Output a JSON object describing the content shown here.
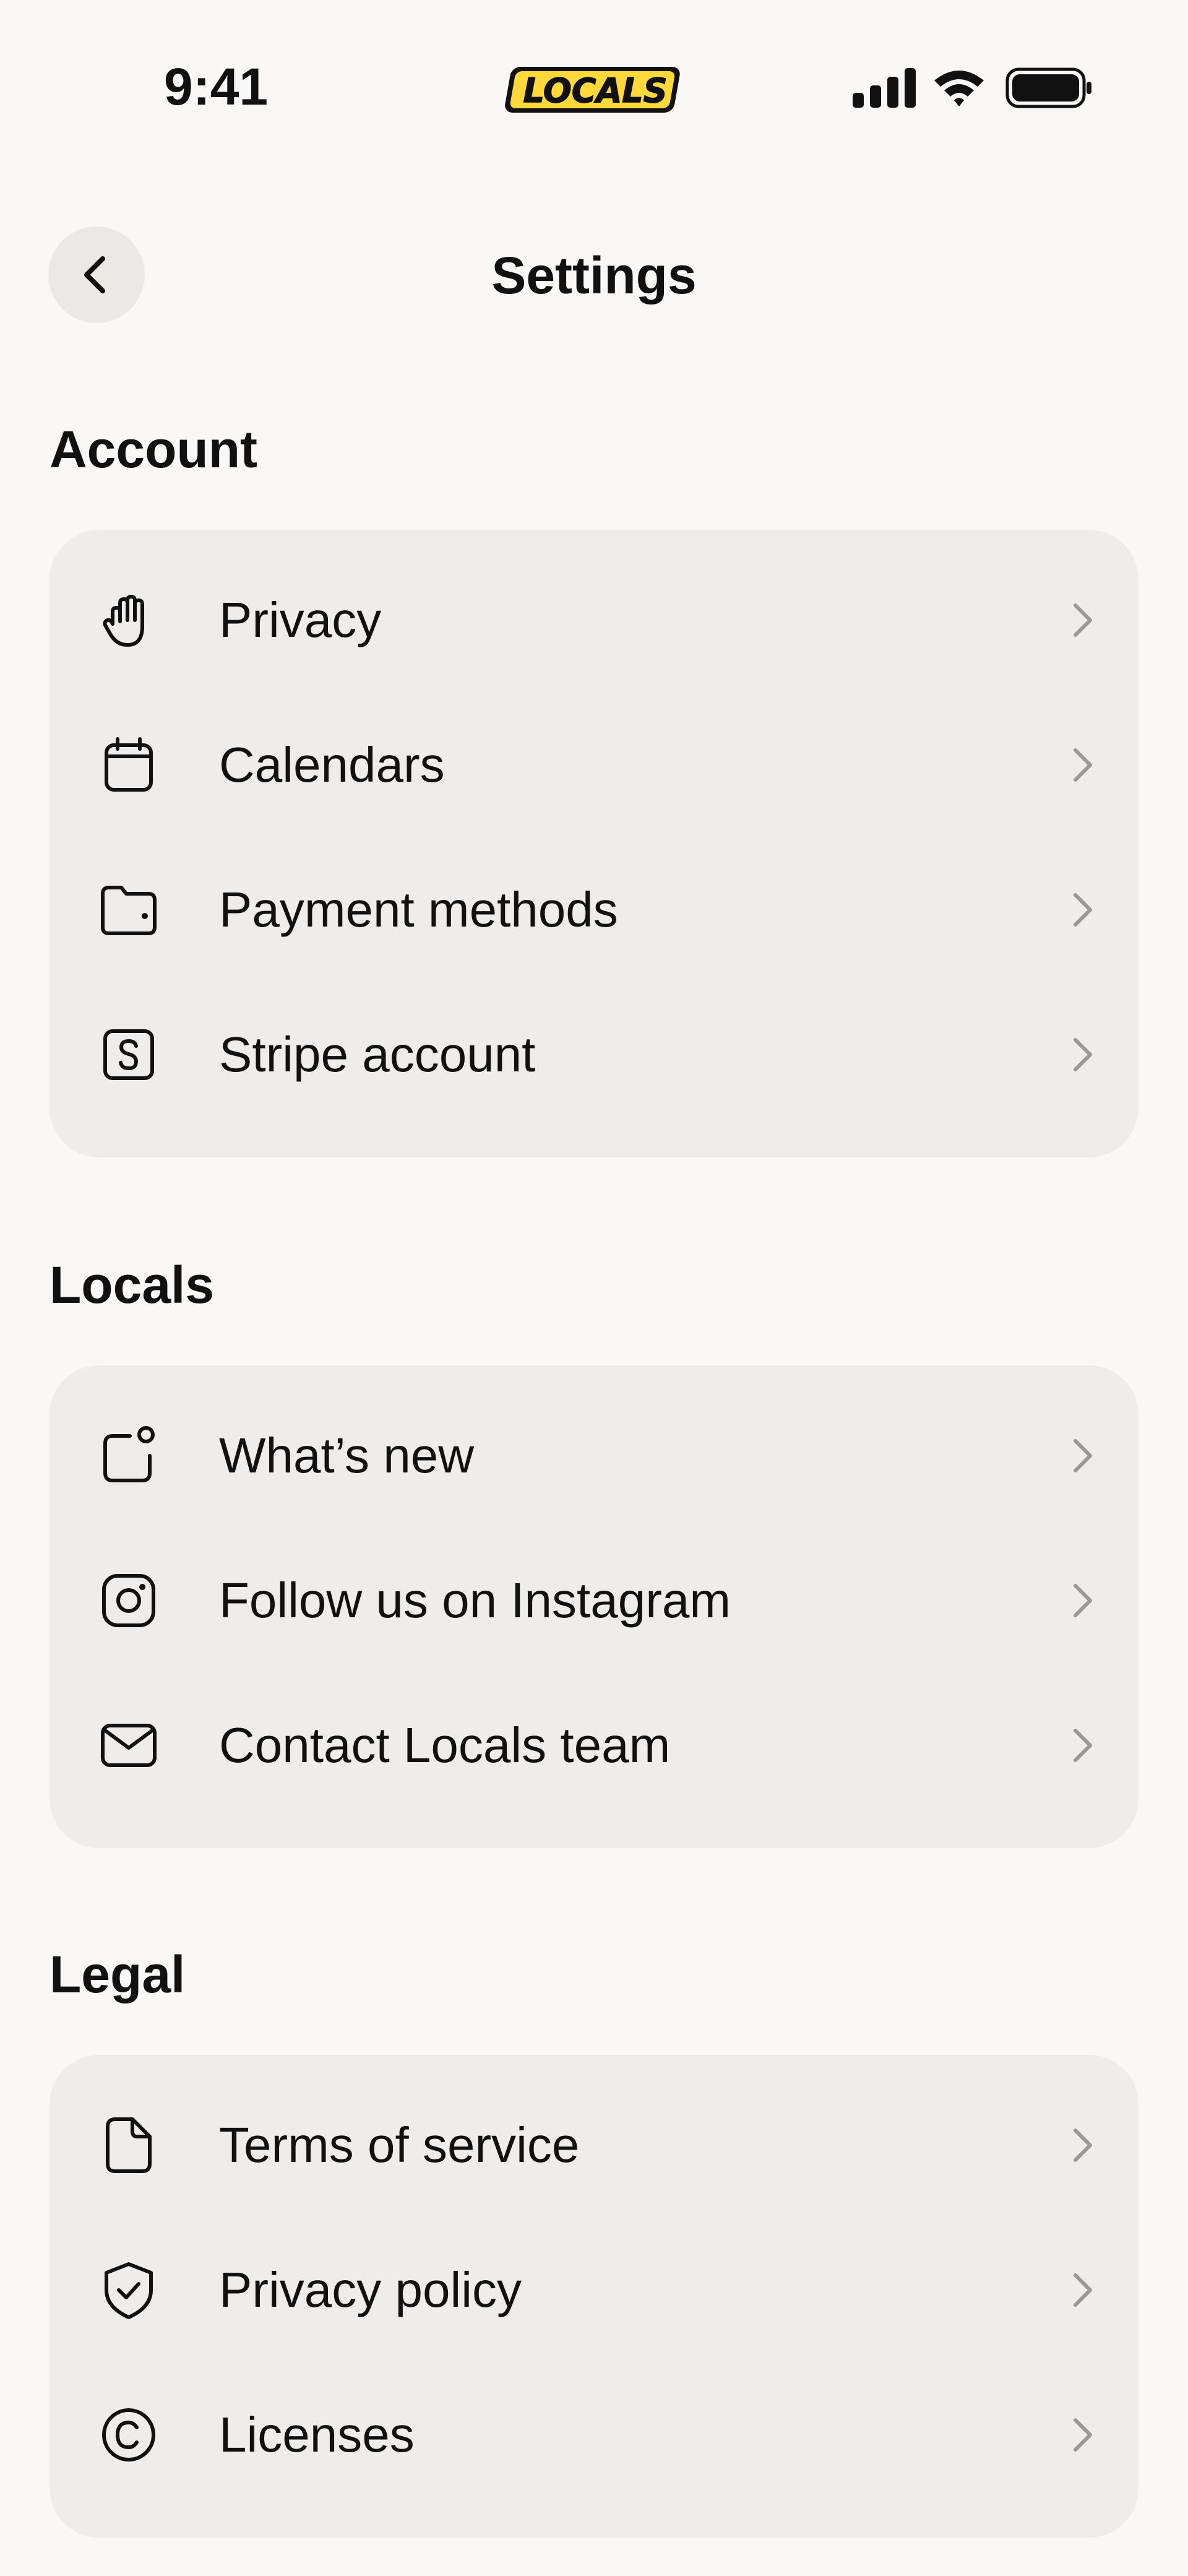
{
  "status_bar": {
    "time": "9:41",
    "logo_text": "LOCALS"
  },
  "header": {
    "title": "Settings"
  },
  "sections": [
    {
      "heading": "Account",
      "items": [
        {
          "label": "Privacy",
          "icon": "hand-icon"
        },
        {
          "label": "Calendars",
          "icon": "calendar-icon"
        },
        {
          "label": "Payment methods",
          "icon": "wallet-icon"
        },
        {
          "label": "Stripe account",
          "icon": "stripe-icon"
        }
      ]
    },
    {
      "heading": "Locals",
      "items": [
        {
          "label": "What’s new",
          "icon": "notification-icon"
        },
        {
          "label": "Follow us on Instagram",
          "icon": "instagram-icon"
        },
        {
          "label": "Contact Locals team",
          "icon": "mail-icon"
        }
      ]
    },
    {
      "heading": "Legal",
      "items": [
        {
          "label": "Terms of service",
          "icon": "document-icon"
        },
        {
          "label": "Privacy policy",
          "icon": "shield-check-icon"
        },
        {
          "label": "Licenses",
          "icon": "copyright-icon"
        }
      ]
    }
  ],
  "colors": {
    "background": "#f9f8f6",
    "card": "#eeedeb",
    "back_button": "#ebe9e6",
    "logo_yellow": "#ffd93b",
    "chevron": "#9a9996",
    "text": "#111111"
  }
}
